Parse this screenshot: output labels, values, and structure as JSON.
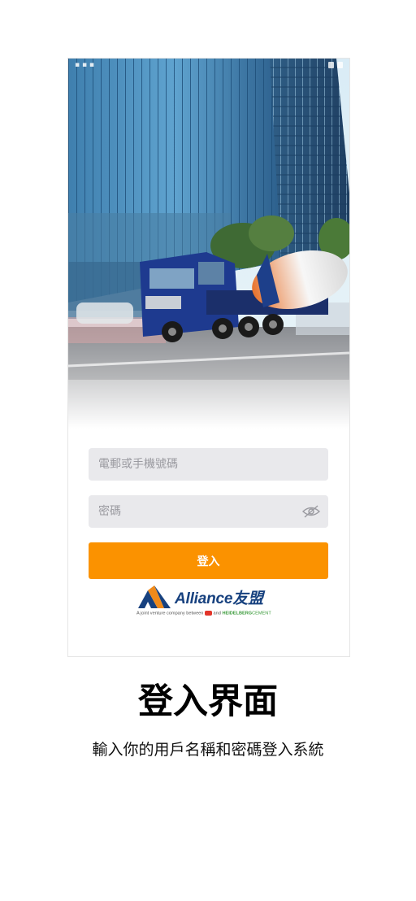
{
  "login": {
    "email_placeholder": "電郵或手機號碼",
    "email_value": "",
    "password_placeholder": "密碼",
    "password_value": "",
    "submit_label": "登入"
  },
  "brand": {
    "name": "Alliance友盟",
    "tagline_prefix": "A joint venture company between",
    "tagline_and": "and",
    "tagline_partner": "HEIDELBERG",
    "tagline_partner_suffix": "CEMENT"
  },
  "caption": {
    "title": "登入界面",
    "subtitle": "輸入你的用戶名稱和密碼登入系統"
  },
  "colors": {
    "accent": "#fb9200",
    "brand_blue": "#17417f",
    "field_bg": "#e9e9ec"
  },
  "icons": {
    "password_toggle": "eye-off-icon",
    "logo": "alliance-triangle-logo"
  }
}
